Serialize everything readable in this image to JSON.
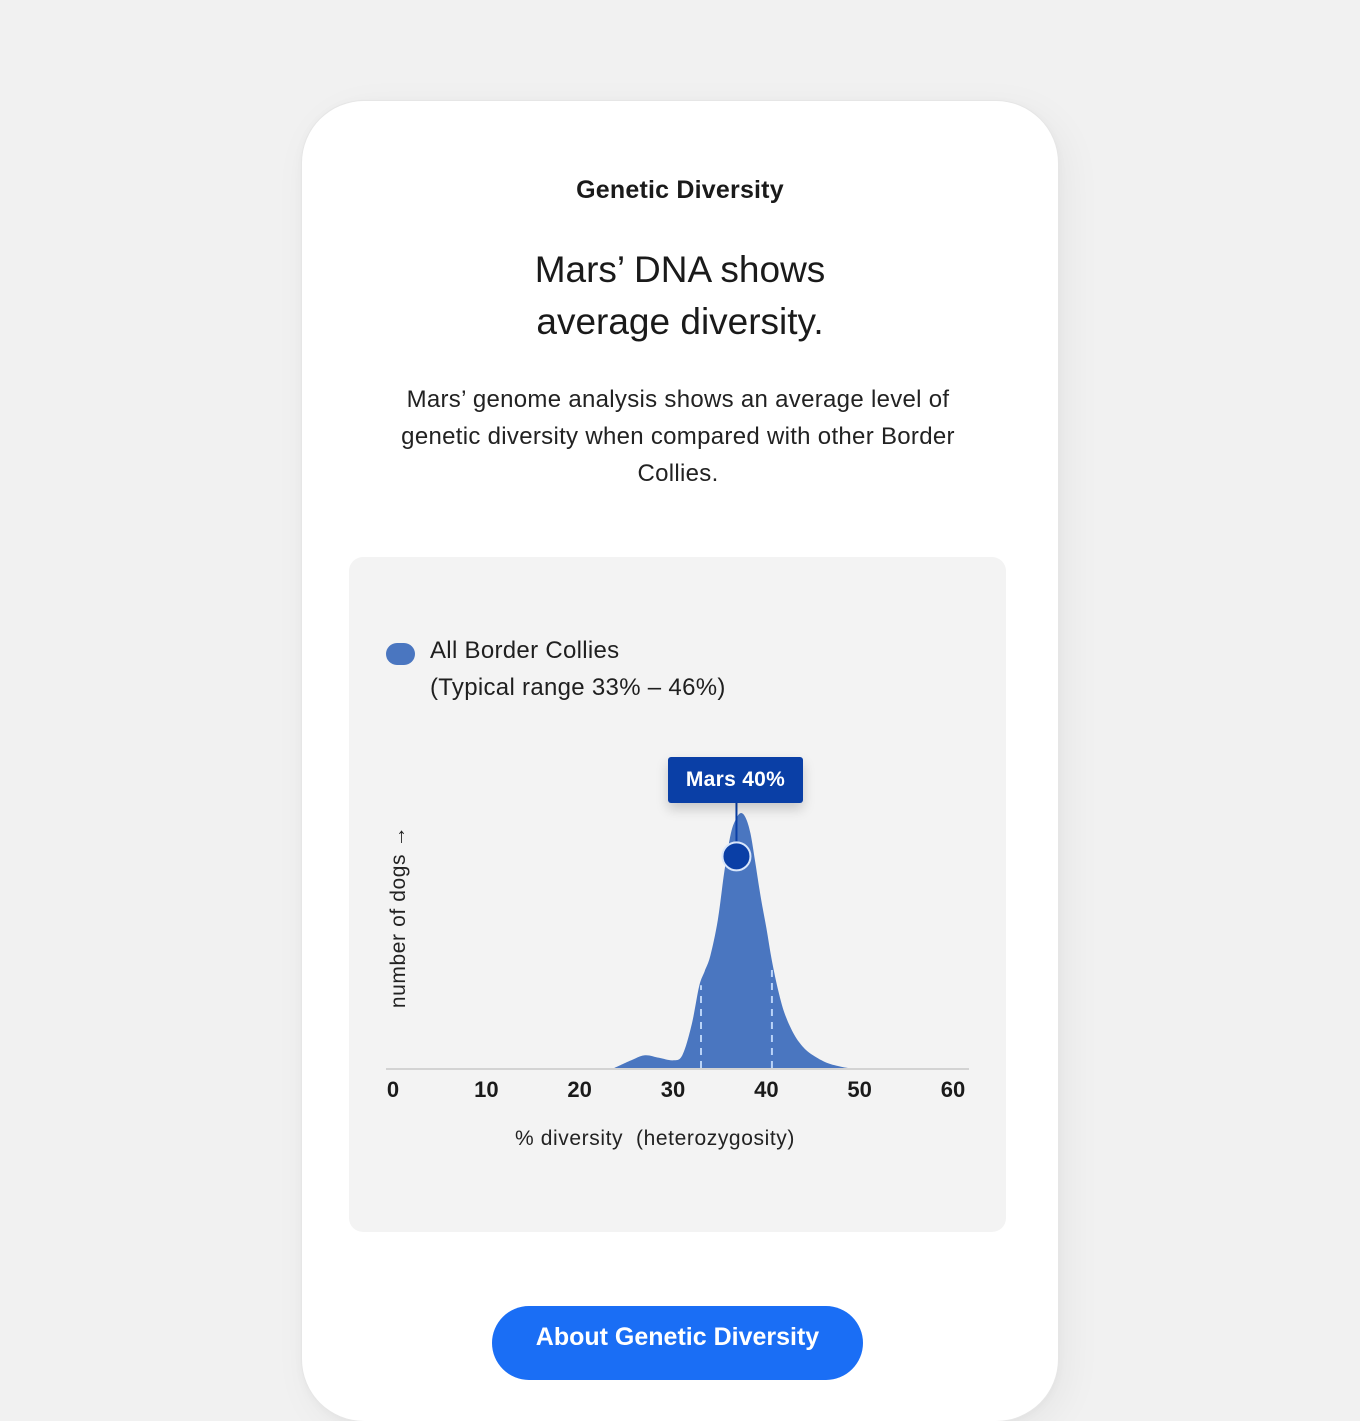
{
  "card": {
    "eyebrow": "Genetic Diversity",
    "headline_line1": "Mars’ DNA shows",
    "headline_line2": "average diversity.",
    "body": "Mars’ genome analysis shows an average level of genetic diversity when compared with other Border Collies."
  },
  "legend": {
    "label_line1": "All Border Collies",
    "label_line2": "(Typical range 33% – 46%)",
    "swatch_color": "#4a76c0"
  },
  "marker": {
    "label": "Mars 40%",
    "color": "#0a3fa6"
  },
  "cta": {
    "label": "About Genetic Diversity",
    "color": "#1a6ef5"
  },
  "chart_data": {
    "type": "area",
    "title": "",
    "xlabel": "% diversity  (heterozygosity)",
    "ylabel": "number of dogs →",
    "xlim": [
      0,
      60
    ],
    "ylim": [
      0,
      1
    ],
    "x_ticks": [
      0,
      10,
      20,
      30,
      40,
      50,
      60
    ],
    "x_tick_labels": [
      "0",
      "10",
      "20",
      "30",
      "40",
      "50",
      "60"
    ],
    "grid": false,
    "legend_position": "top-left",
    "series": [
      {
        "name": "All Border Collies",
        "color": "#4a76c0",
        "x": [
          23.7,
          25.5,
          27.0,
          28.5,
          30.0,
          31.0,
          32.0,
          32.8,
          33.4,
          34.0,
          34.8,
          35.5,
          36.2,
          36.8,
          37.3,
          37.8,
          38.3,
          38.8,
          39.4,
          40.0,
          40.6,
          41.3,
          42.0,
          43.0,
          44.0,
          45.0,
          46.5,
          48.0,
          48.8
        ],
        "y": [
          0.0,
          0.03,
          0.05,
          0.04,
          0.03,
          0.05,
          0.17,
          0.32,
          0.38,
          0.44,
          0.58,
          0.77,
          0.92,
          0.98,
          1.0,
          0.98,
          0.92,
          0.81,
          0.67,
          0.55,
          0.42,
          0.3,
          0.21,
          0.13,
          0.08,
          0.05,
          0.02,
          0.005,
          0.0
        ]
      }
    ],
    "typical_range": [
      33,
      40.6
    ],
    "typical_range_label": "Typical range 33% – 46%",
    "highlight": {
      "label": "Mars 40%",
      "x": 36.8,
      "y": 0.83
    }
  }
}
